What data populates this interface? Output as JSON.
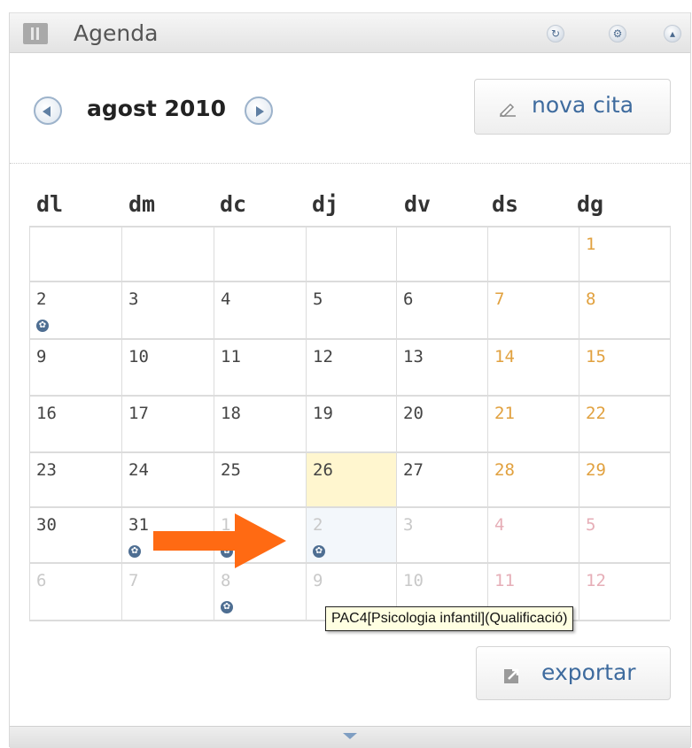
{
  "widget": {
    "title": "Agenda",
    "title_icon": "book-icon",
    "controls": [
      {
        "name": "refresh-icon",
        "glyph": "↻"
      },
      {
        "name": "gear-icon",
        "glyph": "⚙"
      },
      {
        "name": "collapse-icon",
        "glyph": "▴"
      }
    ]
  },
  "nav": {
    "month_label": "agost 2010",
    "prev_icon": "chevron-left-icon",
    "next_icon": "chevron-right-icon"
  },
  "buttons": {
    "new_appointment": "nova cita",
    "export": "exportar"
  },
  "calendar": {
    "weekdays": [
      "dl",
      "dm",
      "dc",
      "dj",
      "dv",
      "ds",
      "dg"
    ],
    "weeks": [
      [
        {
          "day": ""
        },
        {
          "day": ""
        },
        {
          "day": ""
        },
        {
          "day": ""
        },
        {
          "day": ""
        },
        {
          "day": ""
        },
        {
          "day": "1",
          "type": "weekend"
        }
      ],
      [
        {
          "day": "2",
          "type": "cur",
          "events": 1
        },
        {
          "day": "3",
          "type": "cur"
        },
        {
          "day": "4",
          "type": "cur"
        },
        {
          "day": "5",
          "type": "cur"
        },
        {
          "day": "6",
          "type": "cur"
        },
        {
          "day": "7",
          "type": "weekend"
        },
        {
          "day": "8",
          "type": "weekend"
        }
      ],
      [
        {
          "day": "9",
          "type": "cur"
        },
        {
          "day": "10",
          "type": "cur"
        },
        {
          "day": "11",
          "type": "cur"
        },
        {
          "day": "12",
          "type": "cur"
        },
        {
          "day": "13",
          "type": "cur"
        },
        {
          "day": "14",
          "type": "weekend"
        },
        {
          "day": "15",
          "type": "weekend"
        }
      ],
      [
        {
          "day": "16",
          "type": "cur"
        },
        {
          "day": "17",
          "type": "cur"
        },
        {
          "day": "18",
          "type": "cur"
        },
        {
          "day": "19",
          "type": "cur"
        },
        {
          "day": "20",
          "type": "cur"
        },
        {
          "day": "21",
          "type": "weekend"
        },
        {
          "day": "22",
          "type": "weekend"
        }
      ],
      [
        {
          "day": "23",
          "type": "cur"
        },
        {
          "day": "24",
          "type": "cur"
        },
        {
          "day": "25",
          "type": "cur"
        },
        {
          "day": "26",
          "type": "cur",
          "today": true
        },
        {
          "day": "27",
          "type": "cur"
        },
        {
          "day": "28",
          "type": "weekend"
        },
        {
          "day": "29",
          "type": "weekend"
        }
      ],
      [
        {
          "day": "30",
          "type": "cur"
        },
        {
          "day": "31",
          "type": "cur",
          "events": 1
        },
        {
          "day": "1",
          "type": "other",
          "events": 2
        },
        {
          "day": "2",
          "type": "other",
          "events": 1,
          "hover": true
        },
        {
          "day": "3",
          "type": "other"
        },
        {
          "day": "4",
          "type": "other-weekend"
        },
        {
          "day": "5",
          "type": "other-weekend"
        }
      ],
      [
        {
          "day": "6",
          "type": "other"
        },
        {
          "day": "7",
          "type": "other"
        },
        {
          "day": "8",
          "type": "other",
          "events": 1
        },
        {
          "day": "9",
          "type": "other"
        },
        {
          "day": "10",
          "type": "other"
        },
        {
          "day": "11",
          "type": "other-weekend"
        },
        {
          "day": "12",
          "type": "other-weekend"
        }
      ]
    ]
  },
  "tooltip": {
    "text": "PAC4[Psicologia infantil](Qualificació)"
  },
  "annotation": {
    "arrow_color": "#ff6a13"
  },
  "colors": {
    "link_blue": "#3e6b9e",
    "weekend": "#e1a13f",
    "today_bg": "#fff6cf"
  }
}
